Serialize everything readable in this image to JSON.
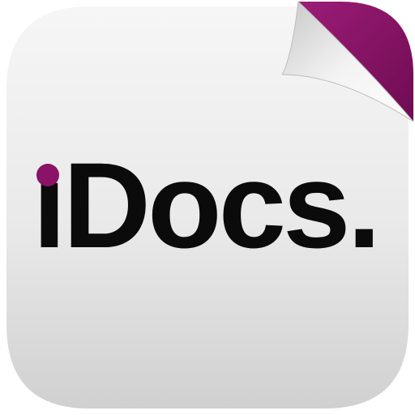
{
  "app": {
    "name_prefix": "ı",
    "name_rest": "Docs."
  },
  "colors": {
    "accent": "#8a1267",
    "paper_light": "#f7f7f7",
    "paper_dark": "#d4d4d4",
    "text": "#0b0b0b"
  },
  "icons": {
    "logo": "document-page-curl-icon",
    "i_dot": "accent-dot-icon"
  }
}
